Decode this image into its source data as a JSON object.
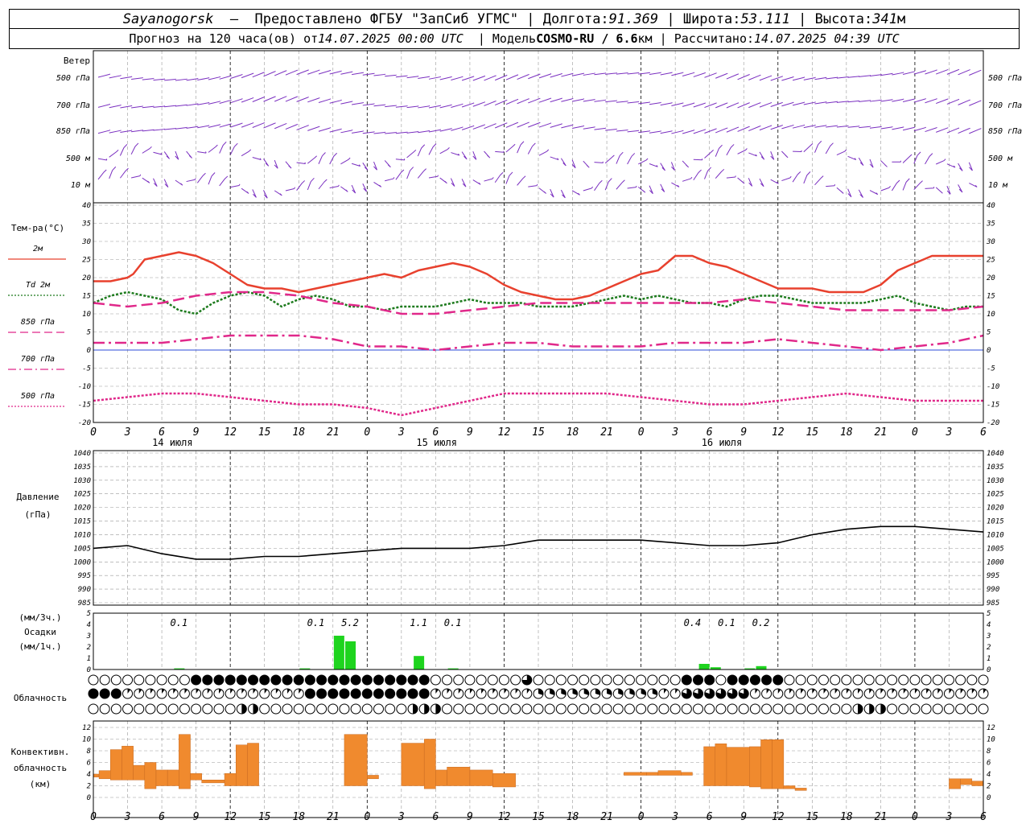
{
  "header": {
    "station": "Sayanogorsk",
    "provided": "Предоставлено ФГБУ \"ЗапСиб УГМС\"",
    "lon_label": "Долгота:",
    "lon": "91.369",
    "lat_label": "Широта:",
    "lat": "53.111",
    "alt_label": "Высота:",
    "alt": "341",
    "alt_unit": "м",
    "forecast_label": "Прогноз на 120 часа(ов) от",
    "init": "14.07.2025 00:00 UTC",
    "model_label": "Модель",
    "model": "COSMO-RU / 6.6",
    "model_unit": "км",
    "calc_label": "Рассчитано:",
    "calc_time": "14.07.2025 04:39 UTC"
  },
  "chart_data": [
    {
      "type": "wind-barbs",
      "title": "Ветер",
      "levels": [
        "500 гПа",
        "700 гПа",
        "850 гПа",
        "500 м",
        "10 м"
      ]
    },
    {
      "type": "line",
      "ylabel": "Тем-ра(°C)",
      "ylim": [
        -20,
        40
      ],
      "yticks": [
        40,
        35,
        30,
        25,
        20,
        15,
        10,
        5,
        0,
        -5,
        -10,
        -15,
        -20
      ],
      "x_ticks": [
        "0",
        "3",
        "6",
        "9",
        "12",
        "15",
        "18",
        "21",
        "0",
        "3",
        "6",
        "9",
        "12",
        "15",
        "18",
        "21",
        "0",
        "3",
        "6",
        "9",
        "12",
        "15",
        "18",
        "21",
        "0",
        "3",
        "6"
      ],
      "day_labels": [
        "14 июля",
        "15 июля",
        "16 июля"
      ],
      "grid": true,
      "legend_position": "left",
      "series": [
        {
          "name": "2м",
          "color": "#e8412e",
          "style": "solid",
          "x": [
            0,
            3,
            6,
            7,
            9,
            12,
            15,
            18,
            21,
            24,
            27,
            30,
            33,
            36,
            39,
            42,
            45,
            48,
            51,
            54,
            57,
            60,
            63,
            66,
            69,
            72,
            75,
            78,
            81,
            84,
            87,
            90,
            93,
            96,
            99,
            102,
            105,
            108,
            111,
            114,
            117,
            120,
            123,
            126,
            129,
            132,
            135,
            138,
            141,
            144,
            147,
            150,
            153,
            156
          ],
          "y": [
            19,
            19,
            20,
            21,
            25,
            26,
            27,
            26,
            24,
            21,
            18,
            17,
            17,
            16,
            17,
            18,
            19,
            20,
            21,
            20,
            22,
            23,
            24,
            23,
            21,
            18,
            16,
            15,
            14,
            14,
            15,
            17,
            19,
            21,
            22,
            26,
            26,
            24,
            23,
            21,
            19,
            17,
            17,
            17,
            16,
            16,
            16,
            18,
            22,
            24,
            26,
            26,
            26,
            26
          ]
        },
        {
          "name": "Td 2м",
          "color": "#1c7a1c",
          "style": "dotted",
          "x": [
            0,
            3,
            6,
            9,
            12,
            15,
            18,
            21,
            24,
            27,
            30,
            33,
            36,
            39,
            42,
            45,
            48,
            51,
            54,
            57,
            60,
            63,
            66,
            69,
            72,
            75,
            78,
            81,
            84,
            87,
            90,
            93,
            96,
            99,
            102,
            105,
            108,
            111,
            114,
            117,
            120,
            123,
            126,
            129,
            132,
            135,
            138,
            141,
            144,
            147,
            150,
            153,
            156
          ],
          "y": [
            13,
            15,
            16,
            15,
            14,
            11,
            10,
            13,
            15,
            16,
            15,
            12,
            14,
            15,
            14,
            12,
            12,
            11,
            12,
            12,
            12,
            13,
            14,
            13,
            13,
            13,
            12,
            12,
            12,
            13,
            14,
            15,
            14,
            15,
            14,
            13,
            13,
            12,
            14,
            15,
            15,
            14,
            13,
            13,
            13,
            13,
            14,
            15,
            13,
            12,
            11,
            12,
            12
          ]
        },
        {
          "name": "850 гПа",
          "color": "#e0288a",
          "style": "dashed",
          "x": [
            0,
            6,
            12,
            18,
            24,
            30,
            36,
            42,
            48,
            54,
            60,
            66,
            72,
            78,
            84,
            90,
            96,
            102,
            108,
            114,
            120,
            126,
            132,
            138,
            144,
            150,
            156
          ],
          "y": [
            13,
            12,
            13,
            15,
            16,
            16,
            15,
            13,
            12,
            10,
            10,
            11,
            12,
            13,
            13,
            13,
            13,
            13,
            13,
            14,
            13,
            12,
            11,
            11,
            11,
            11,
            12
          ]
        },
        {
          "name": "700 гПа",
          "color": "#e0288a",
          "style": "dashdot",
          "x": [
            0,
            6,
            12,
            18,
            24,
            30,
            36,
            42,
            48,
            54,
            60,
            66,
            72,
            78,
            84,
            90,
            96,
            102,
            108,
            114,
            120,
            126,
            132,
            138,
            144,
            150,
            156
          ],
          "y": [
            2,
            2,
            2,
            3,
            4,
            4,
            4,
            3,
            1,
            1,
            0,
            1,
            2,
            2,
            1,
            1,
            1,
            2,
            2,
            2,
            3,
            2,
            1,
            0,
            1,
            2,
            4
          ]
        },
        {
          "name": "500 гПа",
          "color": "#e0288a",
          "style": "dotted-fine",
          "x": [
            0,
            6,
            12,
            18,
            24,
            30,
            36,
            42,
            48,
            54,
            60,
            66,
            72,
            78,
            84,
            90,
            96,
            102,
            108,
            114,
            120,
            126,
            132,
            138,
            144,
            150,
            156
          ],
          "y": [
            -14,
            -13,
            -12,
            -12,
            -13,
            -14,
            -15,
            -15,
            -16,
            -18,
            -16,
            -14,
            -12,
            -12,
            -12,
            -12,
            -13,
            -14,
            -15,
            -15,
            -14,
            -13,
            -12,
            -13,
            -14,
            -14,
            -14
          ]
        }
      ]
    },
    {
      "type": "line",
      "ylabel": "Давление",
      "ylabel2": "(гПа)",
      "ylim": [
        985,
        1040
      ],
      "yticks": [
        1040,
        1035,
        1030,
        1025,
        1020,
        1015,
        1010,
        1005,
        1000,
        995,
        990,
        985
      ],
      "series": [
        {
          "name": "Давление",
          "color": "#000000",
          "x": [
            0,
            6,
            12,
            18,
            24,
            30,
            36,
            42,
            48,
            54,
            60,
            66,
            72,
            78,
            84,
            90,
            96,
            102,
            108,
            114,
            120,
            126,
            132,
            138,
            144,
            150,
            156
          ],
          "y": [
            1005,
            1006,
            1003,
            1001,
            1001,
            1002,
            1002,
            1003,
            1004,
            1005,
            1005,
            1005,
            1006,
            1008,
            1008,
            1008,
            1008,
            1007,
            1006,
            1006,
            1007,
            1010,
            1012,
            1013,
            1013,
            1012,
            1011
          ]
        }
      ]
    },
    {
      "type": "bar",
      "ylabel": "(мм/3ч.)",
      "ylabel2": "Осадки",
      "ylabel3": "(мм/1ч.)",
      "ylim": [
        0,
        5
      ],
      "yticks": [
        5,
        4,
        3,
        2,
        1,
        0
      ],
      "x": [
        15,
        37,
        43,
        45,
        57,
        63,
        107,
        109,
        115,
        117
      ],
      "values": [
        0.1,
        0.1,
        3,
        2.5,
        1.2,
        0.1,
        0.5,
        0.2,
        0.1,
        0.3
      ],
      "annotations": [
        {
          "x": 15,
          "text": "0.1"
        },
        {
          "x": 39,
          "text": "0.1"
        },
        {
          "x": 45,
          "text": "5.2"
        },
        {
          "x": 57,
          "text": "1.1"
        },
        {
          "x": 63,
          "text": "0.1"
        },
        {
          "x": 105,
          "text": "0.4"
        },
        {
          "x": 111,
          "text": "0.1"
        },
        {
          "x": 117,
          "text": "0.2"
        }
      ]
    },
    {
      "type": "cloud-symbols",
      "label": "Облачность",
      "rows": 3
    },
    {
      "type": "bar",
      "ylabel": "Конвективн.",
      "ylabel2": "облачность",
      "ylabel3": "(км)",
      "ylim": [
        0,
        13
      ],
      "yticks": [
        12,
        10,
        8,
        6,
        4,
        2,
        0
      ],
      "bars": [
        {
          "x0": 0,
          "x1": 1,
          "lo": 3.5,
          "hi": 4
        },
        {
          "x0": 1,
          "x1": 3,
          "lo": 3.2,
          "hi": 4.6
        },
        {
          "x0": 3,
          "x1": 5,
          "lo": 3,
          "hi": 8.2
        },
        {
          "x0": 5,
          "x1": 7,
          "lo": 3,
          "hi": 8.8
        },
        {
          "x0": 7,
          "x1": 9,
          "lo": 3,
          "hi": 5.5
        },
        {
          "x0": 9,
          "x1": 11,
          "lo": 1.5,
          "hi": 6
        },
        {
          "x0": 11,
          "x1": 13,
          "lo": 2,
          "hi": 4.7
        },
        {
          "x0": 13,
          "x1": 15,
          "lo": 2,
          "hi": 4.7
        },
        {
          "x0": 15,
          "x1": 17,
          "lo": 1.5,
          "hi": 10.8
        },
        {
          "x0": 17,
          "x1": 19,
          "lo": 3,
          "hi": 4.1
        },
        {
          "x0": 19,
          "x1": 23,
          "lo": 2.5,
          "hi": 3
        },
        {
          "x0": 23,
          "x1": 25,
          "lo": 2,
          "hi": 4.1
        },
        {
          "x0": 25,
          "x1": 27,
          "lo": 2,
          "hi": 9
        },
        {
          "x0": 27,
          "x1": 29,
          "lo": 2,
          "hi": 9.3
        },
        {
          "x0": 44,
          "x1": 48,
          "lo": 2,
          "hi": 10.8
        },
        {
          "x0": 48,
          "x1": 50,
          "lo": 3.2,
          "hi": 3.8
        },
        {
          "x0": 54,
          "x1": 58,
          "lo": 2,
          "hi": 9.3
        },
        {
          "x0": 58,
          "x1": 60,
          "lo": 1.5,
          "hi": 10
        },
        {
          "x0": 60,
          "x1": 62,
          "lo": 2,
          "hi": 4.7
        },
        {
          "x0": 62,
          "x1": 66,
          "lo": 2,
          "hi": 5.2
        },
        {
          "x0": 66,
          "x1": 70,
          "lo": 2,
          "hi": 4.7
        },
        {
          "x0": 70,
          "x1": 74,
          "lo": 1.8,
          "hi": 4.1
        },
        {
          "x0": 93,
          "x1": 97,
          "lo": 3.8,
          "hi": 4.3
        },
        {
          "x0": 97,
          "x1": 99,
          "lo": 3.8,
          "hi": 4.3
        },
        {
          "x0": 99,
          "x1": 103,
          "lo": 3.8,
          "hi": 4.6
        },
        {
          "x0": 103,
          "x1": 105,
          "lo": 3.8,
          "hi": 4.3
        },
        {
          "x0": 107,
          "x1": 109,
          "lo": 2,
          "hi": 8.7
        },
        {
          "x0": 109,
          "x1": 111,
          "lo": 2,
          "hi": 9.2
        },
        {
          "x0": 111,
          "x1": 115,
          "lo": 2,
          "hi": 8.6
        },
        {
          "x0": 115,
          "x1": 117,
          "lo": 1.8,
          "hi": 8.7
        },
        {
          "x0": 117,
          "x1": 119,
          "lo": 1.5,
          "hi": 9.9
        },
        {
          "x0": 119,
          "x1": 121,
          "lo": 1.5,
          "hi": 9.9
        },
        {
          "x0": 121,
          "x1": 123,
          "lo": 1.5,
          "hi": 2
        },
        {
          "x0": 123,
          "x1": 125,
          "lo": 1.2,
          "hi": 1.6
        },
        {
          "x0": 150,
          "x1": 152,
          "lo": 1.5,
          "hi": 3.2
        },
        {
          "x0": 152,
          "x1": 154,
          "lo": 2.2,
          "hi": 3.2
        },
        {
          "x0": 154,
          "x1": 156,
          "lo": 2,
          "hi": 2.8
        }
      ]
    }
  ],
  "colors": {
    "t2m": "#e8412e",
    "td": "#1c7a1c",
    "upper": "#e0288a",
    "wind": "#7a2fc0",
    "precip": "#1ed41e",
    "convective": "#f08a2e",
    "zero_line": "#2b4bd8",
    "grid": "#999999"
  }
}
